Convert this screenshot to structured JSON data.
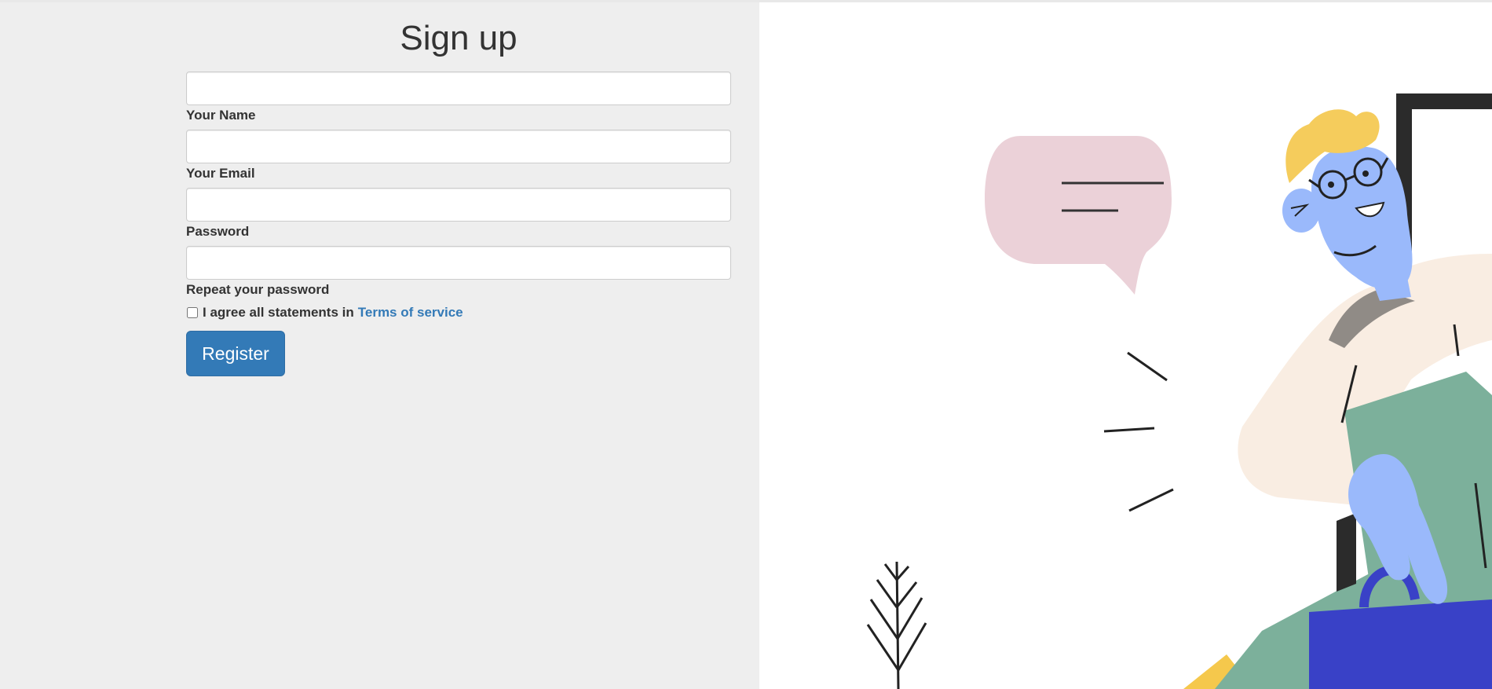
{
  "form": {
    "title": "Sign up",
    "fields": [
      {
        "label": "Your Name",
        "value": "",
        "placeholder": ""
      },
      {
        "label": "Your Email",
        "value": "",
        "placeholder": ""
      },
      {
        "label": "Password",
        "value": "",
        "placeholder": ""
      },
      {
        "label": "Repeat your password",
        "value": "",
        "placeholder": ""
      }
    ],
    "agree_text": "I agree all statements in",
    "terms_link": "Terms of service",
    "agree_checked": false,
    "register_label": "Register"
  },
  "illustration": {
    "name": "person-with-speech-bubble-illustration"
  },
  "colors": {
    "left_panel_bg": "#eeeeee",
    "primary_button": "#337ab7",
    "link": "#337ab7"
  }
}
